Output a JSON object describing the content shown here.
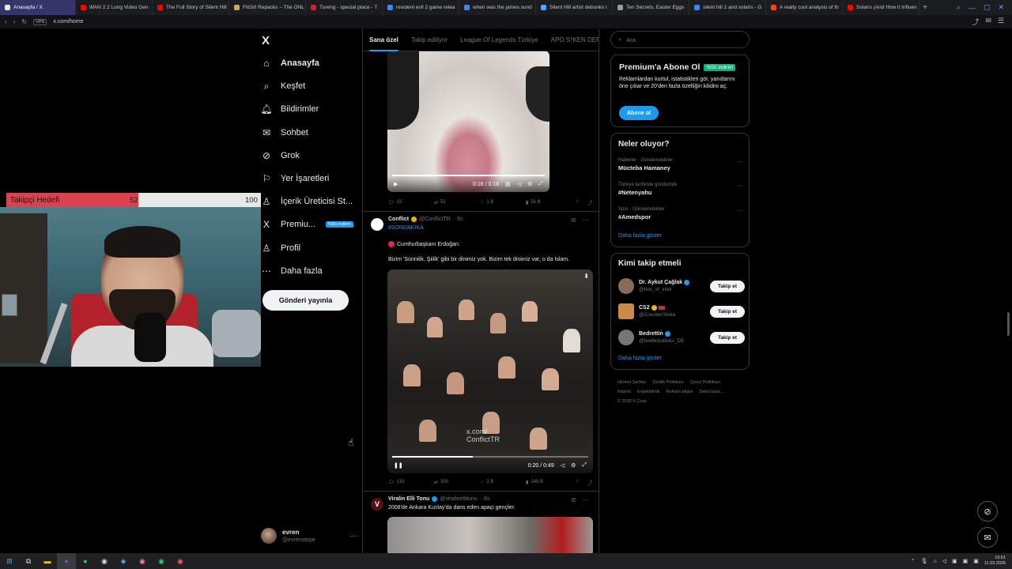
{
  "browser": {
    "tabs": [
      {
        "label": "Anasayfa / X",
        "active": true,
        "color": "#e7e9ea"
      },
      {
        "label": "WAN 2.2 Long Video Gen",
        "color": "#ff0000"
      },
      {
        "label": "The Full Story of Silent Hill",
        "color": "#ff0000"
      },
      {
        "label": "FitGirl Repacks – The ONL",
        "color": "#c8a96a"
      },
      {
        "label": "Tureng - special place - T",
        "color": "#d0242b"
      },
      {
        "label": "resident evil 2 game relea",
        "color": "#4285f4"
      },
      {
        "label": "when was the james sund",
        "color": "#4285f4"
      },
      {
        "label": "Silent Hill artist debunks l",
        "color": "#4da6ff"
      },
      {
        "label": "Ten Secrets, Easter Eggs",
        "color": "#999999"
      },
      {
        "label": "silent hill 2 and solaris - G",
        "color": "#4285f4"
      },
      {
        "label": "A really cool analysis of th",
        "color": "#ff4500"
      },
      {
        "label": "Solaris (And How it Influen",
        "color": "#ff0000"
      }
    ],
    "new_tab": "+",
    "url": "x.com/home",
    "url_badge": "VPN"
  },
  "nav": {
    "logo": "X",
    "items": [
      {
        "label": "Anasayfa",
        "icon": "home-icon",
        "glyph": "⌂",
        "bold": true
      },
      {
        "label": "Keşfet",
        "icon": "search-icon",
        "glyph": "⌕"
      },
      {
        "label": "Bildirimler",
        "icon": "bell-icon",
        "glyph": "🔔︎"
      },
      {
        "label": "Sohbet",
        "icon": "mail-icon",
        "glyph": "✉"
      },
      {
        "label": "Grok",
        "icon": "grok-icon",
        "glyph": "⊘"
      },
      {
        "label": "Yer İşaretleri",
        "icon": "bookmark-icon",
        "glyph": "⚐"
      },
      {
        "label": "İçerik Üreticisi St...",
        "icon": "creator-icon",
        "glyph": "♙"
      },
      {
        "label": "Premiu...",
        "icon": "premium-icon",
        "glyph": "X",
        "tag": "%50 indirim"
      },
      {
        "label": "Profil",
        "icon": "profile-icon",
        "glyph": "♙"
      },
      {
        "label": "Daha fazla",
        "icon": "more-icon",
        "glyph": "⋯"
      }
    ],
    "post_button": "Gönderi yayınla",
    "account": {
      "name": "evren",
      "handle": "@evrenstepe"
    }
  },
  "overlay": {
    "goal_label": "Takipçi Hedefi",
    "goal_current": 52,
    "goal_max": 100
  },
  "feed": {
    "tabs": [
      "Sana özel",
      "Takip ediliyor",
      "League Of Legends Türkiye",
      "APO S*KEN DERNEĞİ"
    ],
    "post1": {
      "time": "0:16 / 0:16",
      "progress": 1.0,
      "stats": {
        "replies": "15",
        "reposts": "52",
        "likes": "1 B",
        "views": "51 B"
      }
    },
    "post2": {
      "name": "Conflict",
      "handle": "@ConflictTR",
      "time": "6s",
      "hashtag": "#SONDAKİKA",
      "line1": "Cumhurbaşkanı Erdoğan:",
      "line2": "Bizim 'Sünnilik, Şiilik' gibi bir dinimiz yok. Bizim tek dinimiz var, o da İslam.",
      "watermark": "x.com/\nConflictTR",
      "video_time": "0:20 / 0:49",
      "progress": 0.41,
      "stats": {
        "replies": "133",
        "reposts": "300",
        "likes": "2 B",
        "views": "248 B"
      }
    },
    "post3": {
      "name": "Viralin Elli Tonu",
      "handle": "@viralinellitonu",
      "time": "6s",
      "text": "2008'de Ankara Kızılay'da dans eden apaçi gençler:"
    }
  },
  "sidebar": {
    "search_placeholder": "Ara",
    "premium": {
      "title": "Premium'a Abone Ol",
      "discount": "%50 indirim",
      "description": "Reklamlardan kurtul, istatistikleri gör, yanıtlarını öne çıkar ve 20'den fazla özelliğin kilidini aç.",
      "button": "Abone ol"
    },
    "trends": {
      "title": "Neler oluyor?",
      "items": [
        {
          "category": "Haberler · Gündemdekiler",
          "name": "Mücteba Hamaney"
        },
        {
          "category": "Türkiye tarihinde gündemde",
          "name": "#Netenyahu"
        },
        {
          "category": "Spor · Gündemdekiler",
          "name": "#Amedspor"
        }
      ],
      "show_more": "Daha fazla göster"
    },
    "who": {
      "title": "Kimi takip etmeli",
      "items": [
        {
          "name": "Dr. Aykut Çağlak",
          "handle": "@hist_of_intel",
          "color": "#8a6a58"
        },
        {
          "name": "CS2",
          "handle": "@CounterStrike",
          "color": "#c98a4a"
        },
        {
          "name": "Bedrettin",
          "handle": "@bedbolukbasi_DE",
          "color": "#777777"
        }
      ],
      "follow_label": "Takip et",
      "show_more": "Daha fazla göster"
    },
    "footer": [
      "Hizmet Şartları",
      "Gizlilik Politikası",
      "Çerez Politikası",
      "İmprint",
      "Erişilebilirlik",
      "Reklam bilgisi",
      "Daha fazla ...",
      "© 2026 X Corp."
    ]
  },
  "taskbar": {
    "time": "19:51",
    "date": "11.03.2026"
  },
  "colors": {
    "accent": "#1d9bf0",
    "goal_fill": "#d8434f",
    "green": "#00ba7c"
  }
}
